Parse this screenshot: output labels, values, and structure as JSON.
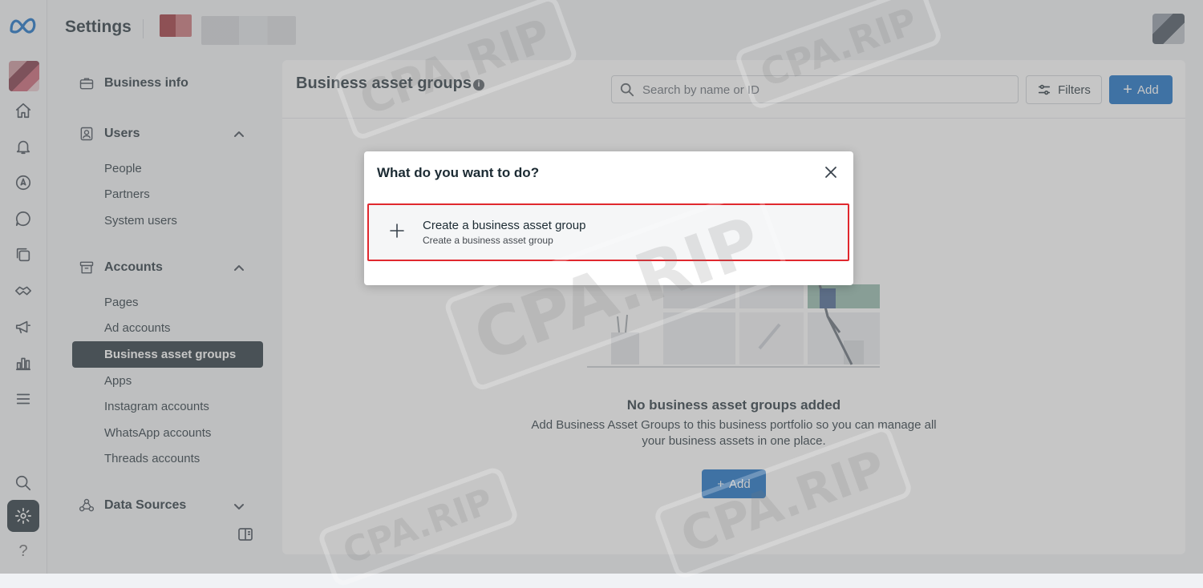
{
  "header": {
    "title": "Settings"
  },
  "menu": {
    "business_info": "Business info",
    "users": {
      "label": "Users",
      "items": [
        "People",
        "Partners",
        "System users"
      ]
    },
    "accounts": {
      "label": "Accounts",
      "items": [
        "Pages",
        "Ad accounts",
        "Business asset groups",
        "Apps",
        "Instagram accounts",
        "WhatsApp accounts",
        "Threads accounts"
      ],
      "selected": "Business asset groups"
    },
    "data_sources": "Data Sources"
  },
  "main": {
    "title": "Business asset groups",
    "search_placeholder": "Search by name or ID",
    "filters_label": "Filters",
    "add_label": "Add",
    "empty_title": "No business asset groups added",
    "empty_description": "Add Business Asset Groups to this business portfolio so you can manage all your business assets in one place.",
    "empty_add_label": "Add"
  },
  "modal": {
    "title": "What do you want to do?",
    "option": {
      "label": "Create a business asset group",
      "description": "Create a business asset group"
    }
  },
  "watermark": "CPA.RIP",
  "colors": {
    "primary": "#0a66c2",
    "highlight_border": "#e0282e",
    "selected_nav": "#1c2b33"
  }
}
